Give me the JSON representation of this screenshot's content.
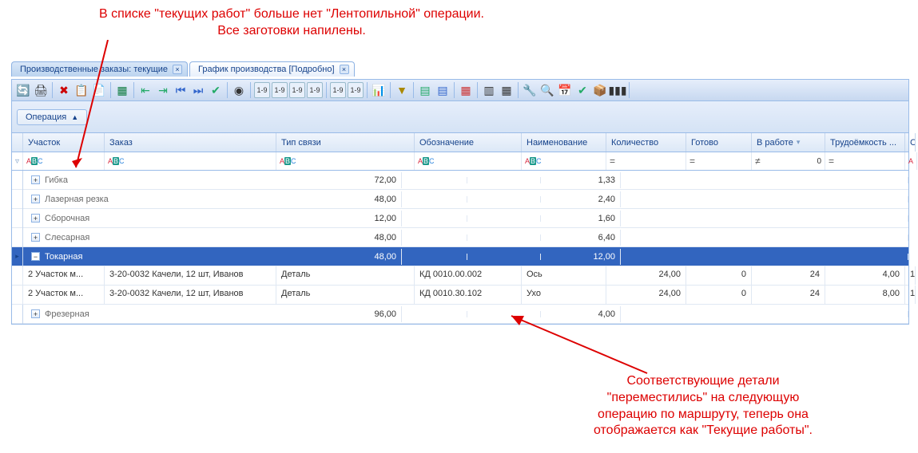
{
  "annotations": {
    "top_line1": "В списке \"текущих работ\" больше нет \"Лентопильной\" операции.",
    "top_line2": "Все заготовки напилены.",
    "bottom_line1": "Соответствующие детали",
    "bottom_line2": "\"переместились\" на следующую",
    "bottom_line3": "операцию по маршруту, теперь она",
    "bottom_line4": "отображается как \"Текущие работы\"."
  },
  "tabs": [
    {
      "label": "Производственные заказы: текущие",
      "active": false
    },
    {
      "label": "График производства [Подробно]",
      "active": true
    }
  ],
  "toolbar_icons": [
    "refresh",
    "print",
    "sep",
    "delete",
    "copy",
    "paste",
    "sep",
    "export-excel",
    "sep",
    "indent-left",
    "indent-right",
    "go-first",
    "go-last",
    "ok-green",
    "sep",
    "chart-pie",
    "sep",
    "num1",
    "num2",
    "num3",
    "num4",
    "sep",
    "num1b",
    "num2b",
    "sep",
    "chart-bar",
    "sep",
    "funnel",
    "sep",
    "table-green",
    "table-blue",
    "sep",
    "gantt-red",
    "sep",
    "table-cols",
    "grid",
    "sep",
    "tools",
    "search",
    "calendar-edit",
    "check-green",
    "box-yellow",
    "barcode",
    "sep"
  ],
  "group_by": {
    "label": "Операция",
    "dir": "▲"
  },
  "columns": {
    "section": "Участок",
    "order": "Заказ",
    "link_type": "Тип связи",
    "designation": "Обозначение",
    "name": "Наименование",
    "qty": "Количество",
    "done": "Готово",
    "in_work": "В работе",
    "labor": "Трудоёмкость ...",
    "last": "С"
  },
  "filter_row": {
    "qty_op": "=",
    "done_op": "=",
    "in_work_op": "≠",
    "in_work_val": "0",
    "labor_op": "="
  },
  "groups": [
    {
      "label": "Гибка",
      "qty": "72,00",
      "labor": "1,33",
      "expanded": false,
      "selected": false
    },
    {
      "label": "Лазерная резка",
      "qty": "48,00",
      "labor": "2,40",
      "expanded": false,
      "selected": false
    },
    {
      "label": "Сборочная",
      "qty": "12,00",
      "labor": "1,60",
      "expanded": false,
      "selected": false
    },
    {
      "label": "Слесарная",
      "qty": "48,00",
      "labor": "6,40",
      "expanded": false,
      "selected": false
    },
    {
      "label": "Токарная",
      "qty": "48,00",
      "labor": "12,00",
      "expanded": true,
      "selected": true,
      "rows": [
        {
          "section": "2 Участок м...",
          "order": "3-20-0032 Качели, 12 шт, Иванов",
          "link_type": "Деталь",
          "designation": "КД 0010.00.002",
          "name": "Ось",
          "qty": "24,00",
          "done": "0",
          "in_work": "24",
          "labor": "4,00",
          "last": "1"
        },
        {
          "section": "2 Участок м...",
          "order": "3-20-0032 Качели, 12 шт, Иванов",
          "link_type": "Деталь",
          "designation": "КД 0010.30.102",
          "name": "Ухо",
          "qty": "24,00",
          "done": "0",
          "in_work": "24",
          "labor": "8,00",
          "last": "1"
        }
      ]
    },
    {
      "label": "Фрезерная",
      "qty": "96,00",
      "labor": "4,00",
      "expanded": false,
      "selected": false
    }
  ]
}
